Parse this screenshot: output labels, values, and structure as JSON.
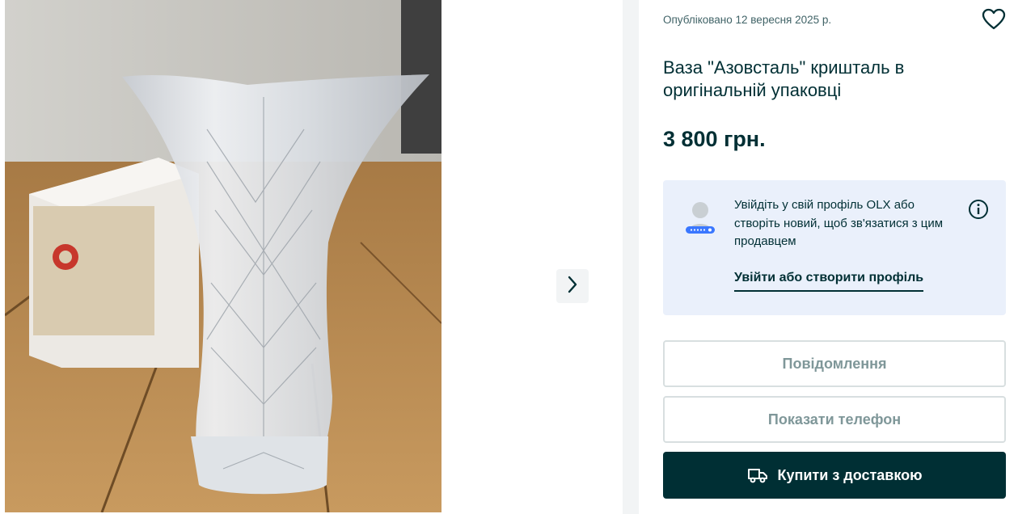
{
  "gallery": {
    "photo_alt": "Ваза \"Азовсталь\" кришталь в оригінальній упаковці"
  },
  "listing": {
    "published": "Опубліковано 12 вересня 2025 р.",
    "title": "Ваза \"Азовсталь\" кришталь в оригінальній упаковці",
    "price": "3 800 грн."
  },
  "login_prompt": {
    "text": "Увійдіть у свій профіль OLX або створіть новий, щоб зв'язатися з цим продавцем",
    "link_label": "Увійти або створити профіль"
  },
  "actions": {
    "message_label": "Повідомлення",
    "phone_label": "Показати телефон",
    "buy_label": "Купити з доставкою"
  },
  "icons": {
    "favorite": "heart-icon",
    "next": "chevron-right-icon",
    "info": "info-icon",
    "delivery": "truck-icon",
    "login": "user-profile-icon"
  },
  "colors": {
    "brand_dark": "#002f34",
    "muted_text": "#406367",
    "login_box_bg": "#eaf0fb",
    "outline_border": "#d8dfe0",
    "outline_text": "#7f9799"
  }
}
